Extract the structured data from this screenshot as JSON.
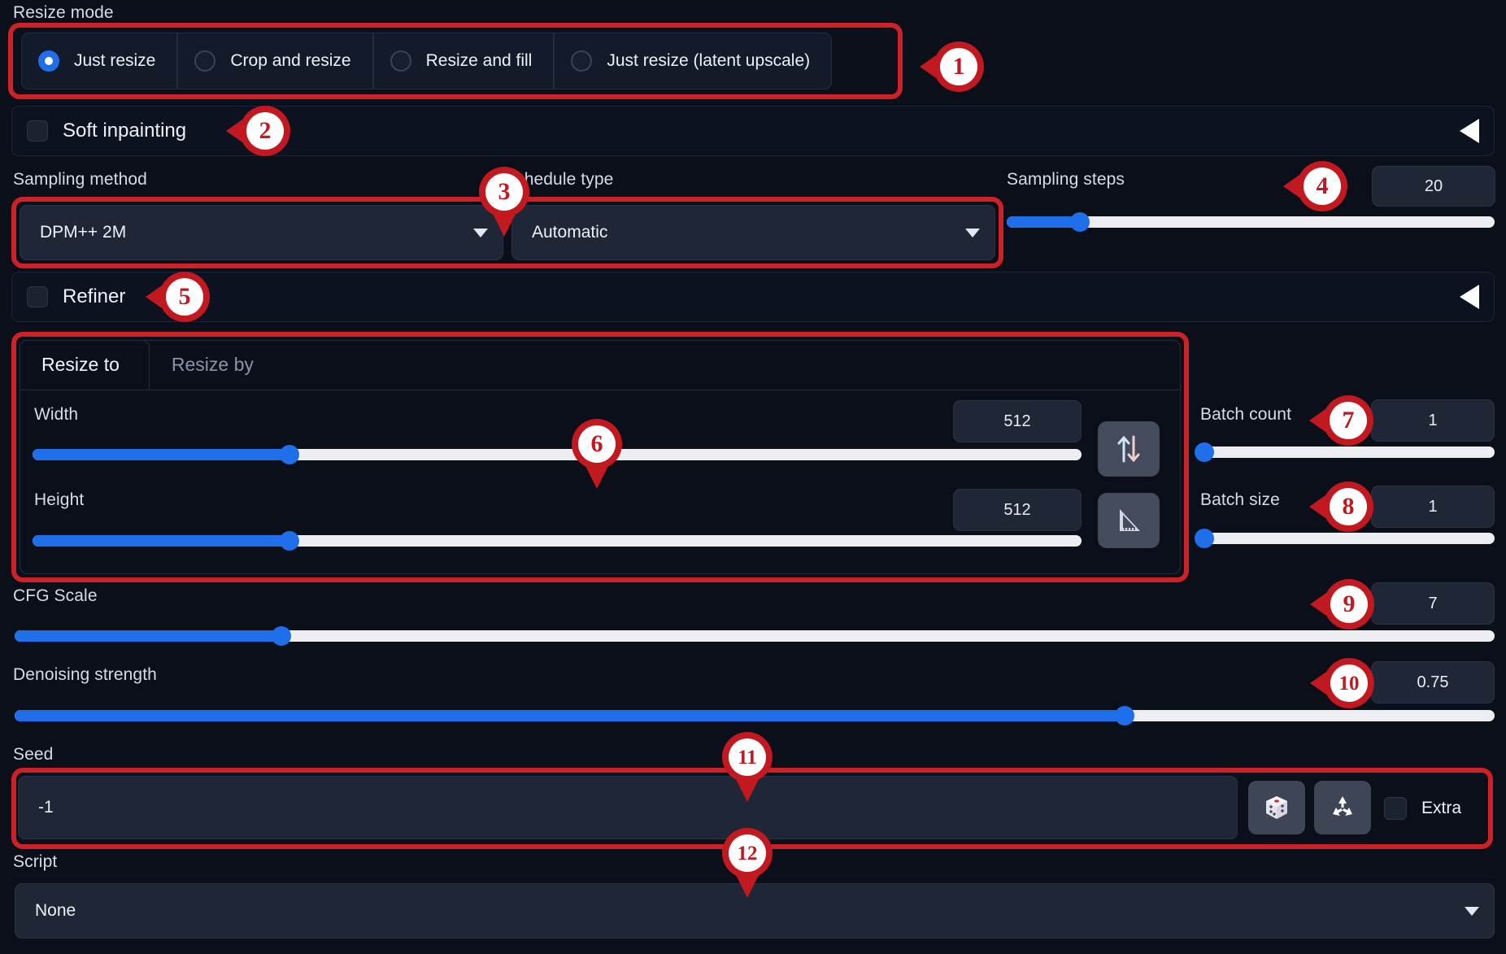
{
  "resize_mode": {
    "label": "Resize mode",
    "options": [
      {
        "label": "Just resize",
        "selected": true
      },
      {
        "label": "Crop and resize",
        "selected": false
      },
      {
        "label": "Resize and fill",
        "selected": false
      },
      {
        "label": "Just resize (latent upscale)",
        "selected": false
      }
    ]
  },
  "soft_inpainting": {
    "label": "Soft inpainting",
    "checked": false
  },
  "sampling": {
    "method_label": "Sampling method",
    "method_value": "DPM++ 2M",
    "schedule_label": "Schedule type",
    "schedule_value": "Automatic",
    "steps_label": "Sampling steps",
    "steps_value": "20"
  },
  "refiner": {
    "label": "Refiner",
    "checked": false
  },
  "resize_panel": {
    "tabs": [
      {
        "label": "Resize to",
        "active": true
      },
      {
        "label": "Resize by",
        "active": false
      }
    ],
    "width_label": "Width",
    "width_value": "512",
    "height_label": "Height",
    "height_value": "512",
    "swap_icon": "swap-vertical-icon",
    "ruler_icon": "triangular-ruler-icon"
  },
  "batch": {
    "count_label": "Batch count",
    "count_value": "1",
    "size_label": "Batch size",
    "size_value": "1"
  },
  "cfg": {
    "label": "CFG Scale",
    "value": "7"
  },
  "denoise": {
    "label": "Denoising strength",
    "value": "0.75"
  },
  "seed": {
    "label": "Seed",
    "value": "-1",
    "dice_icon": "dice-icon",
    "recycle_icon": "recycle-icon",
    "extra_label": "Extra",
    "extra_checked": false
  },
  "script": {
    "label": "Script",
    "value": "None"
  },
  "markers": [
    {
      "n": "1"
    },
    {
      "n": "2"
    },
    {
      "n": "3"
    },
    {
      "n": "4"
    },
    {
      "n": "5"
    },
    {
      "n": "6"
    },
    {
      "n": "7"
    },
    {
      "n": "8"
    },
    {
      "n": "9"
    },
    {
      "n": "10"
    },
    {
      "n": "11"
    },
    {
      "n": "12"
    }
  ],
  "colors": {
    "accent": "#1f6feb",
    "highlight": "#cc2127",
    "marker": "#c2181f",
    "background": "#0b0f19",
    "field": "#1f2736"
  }
}
